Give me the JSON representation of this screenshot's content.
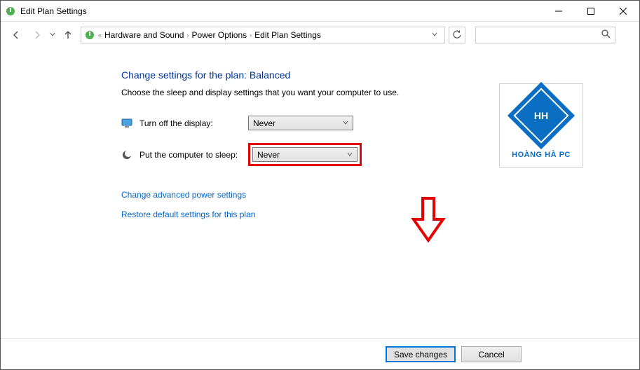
{
  "window": {
    "title": "Edit Plan Settings"
  },
  "breadcrumb": {
    "seg1": "Hardware and Sound",
    "seg2": "Power Options",
    "seg3": "Edit Plan Settings"
  },
  "search": {
    "placeholder": ""
  },
  "page": {
    "heading": "Change settings for the plan: Balanced",
    "subtext": "Choose the sleep and display settings that you want your computer to use."
  },
  "settings": {
    "display": {
      "label": "Turn off the display:",
      "value": "Never"
    },
    "sleep": {
      "label": "Put the computer to sleep:",
      "value": "Never"
    }
  },
  "links": {
    "advanced": "Change advanced power settings",
    "restore": "Restore default settings for this plan"
  },
  "buttons": {
    "save": "Save changes",
    "cancel": "Cancel"
  },
  "logo": {
    "text": "HOÀNG HÀ PC"
  }
}
